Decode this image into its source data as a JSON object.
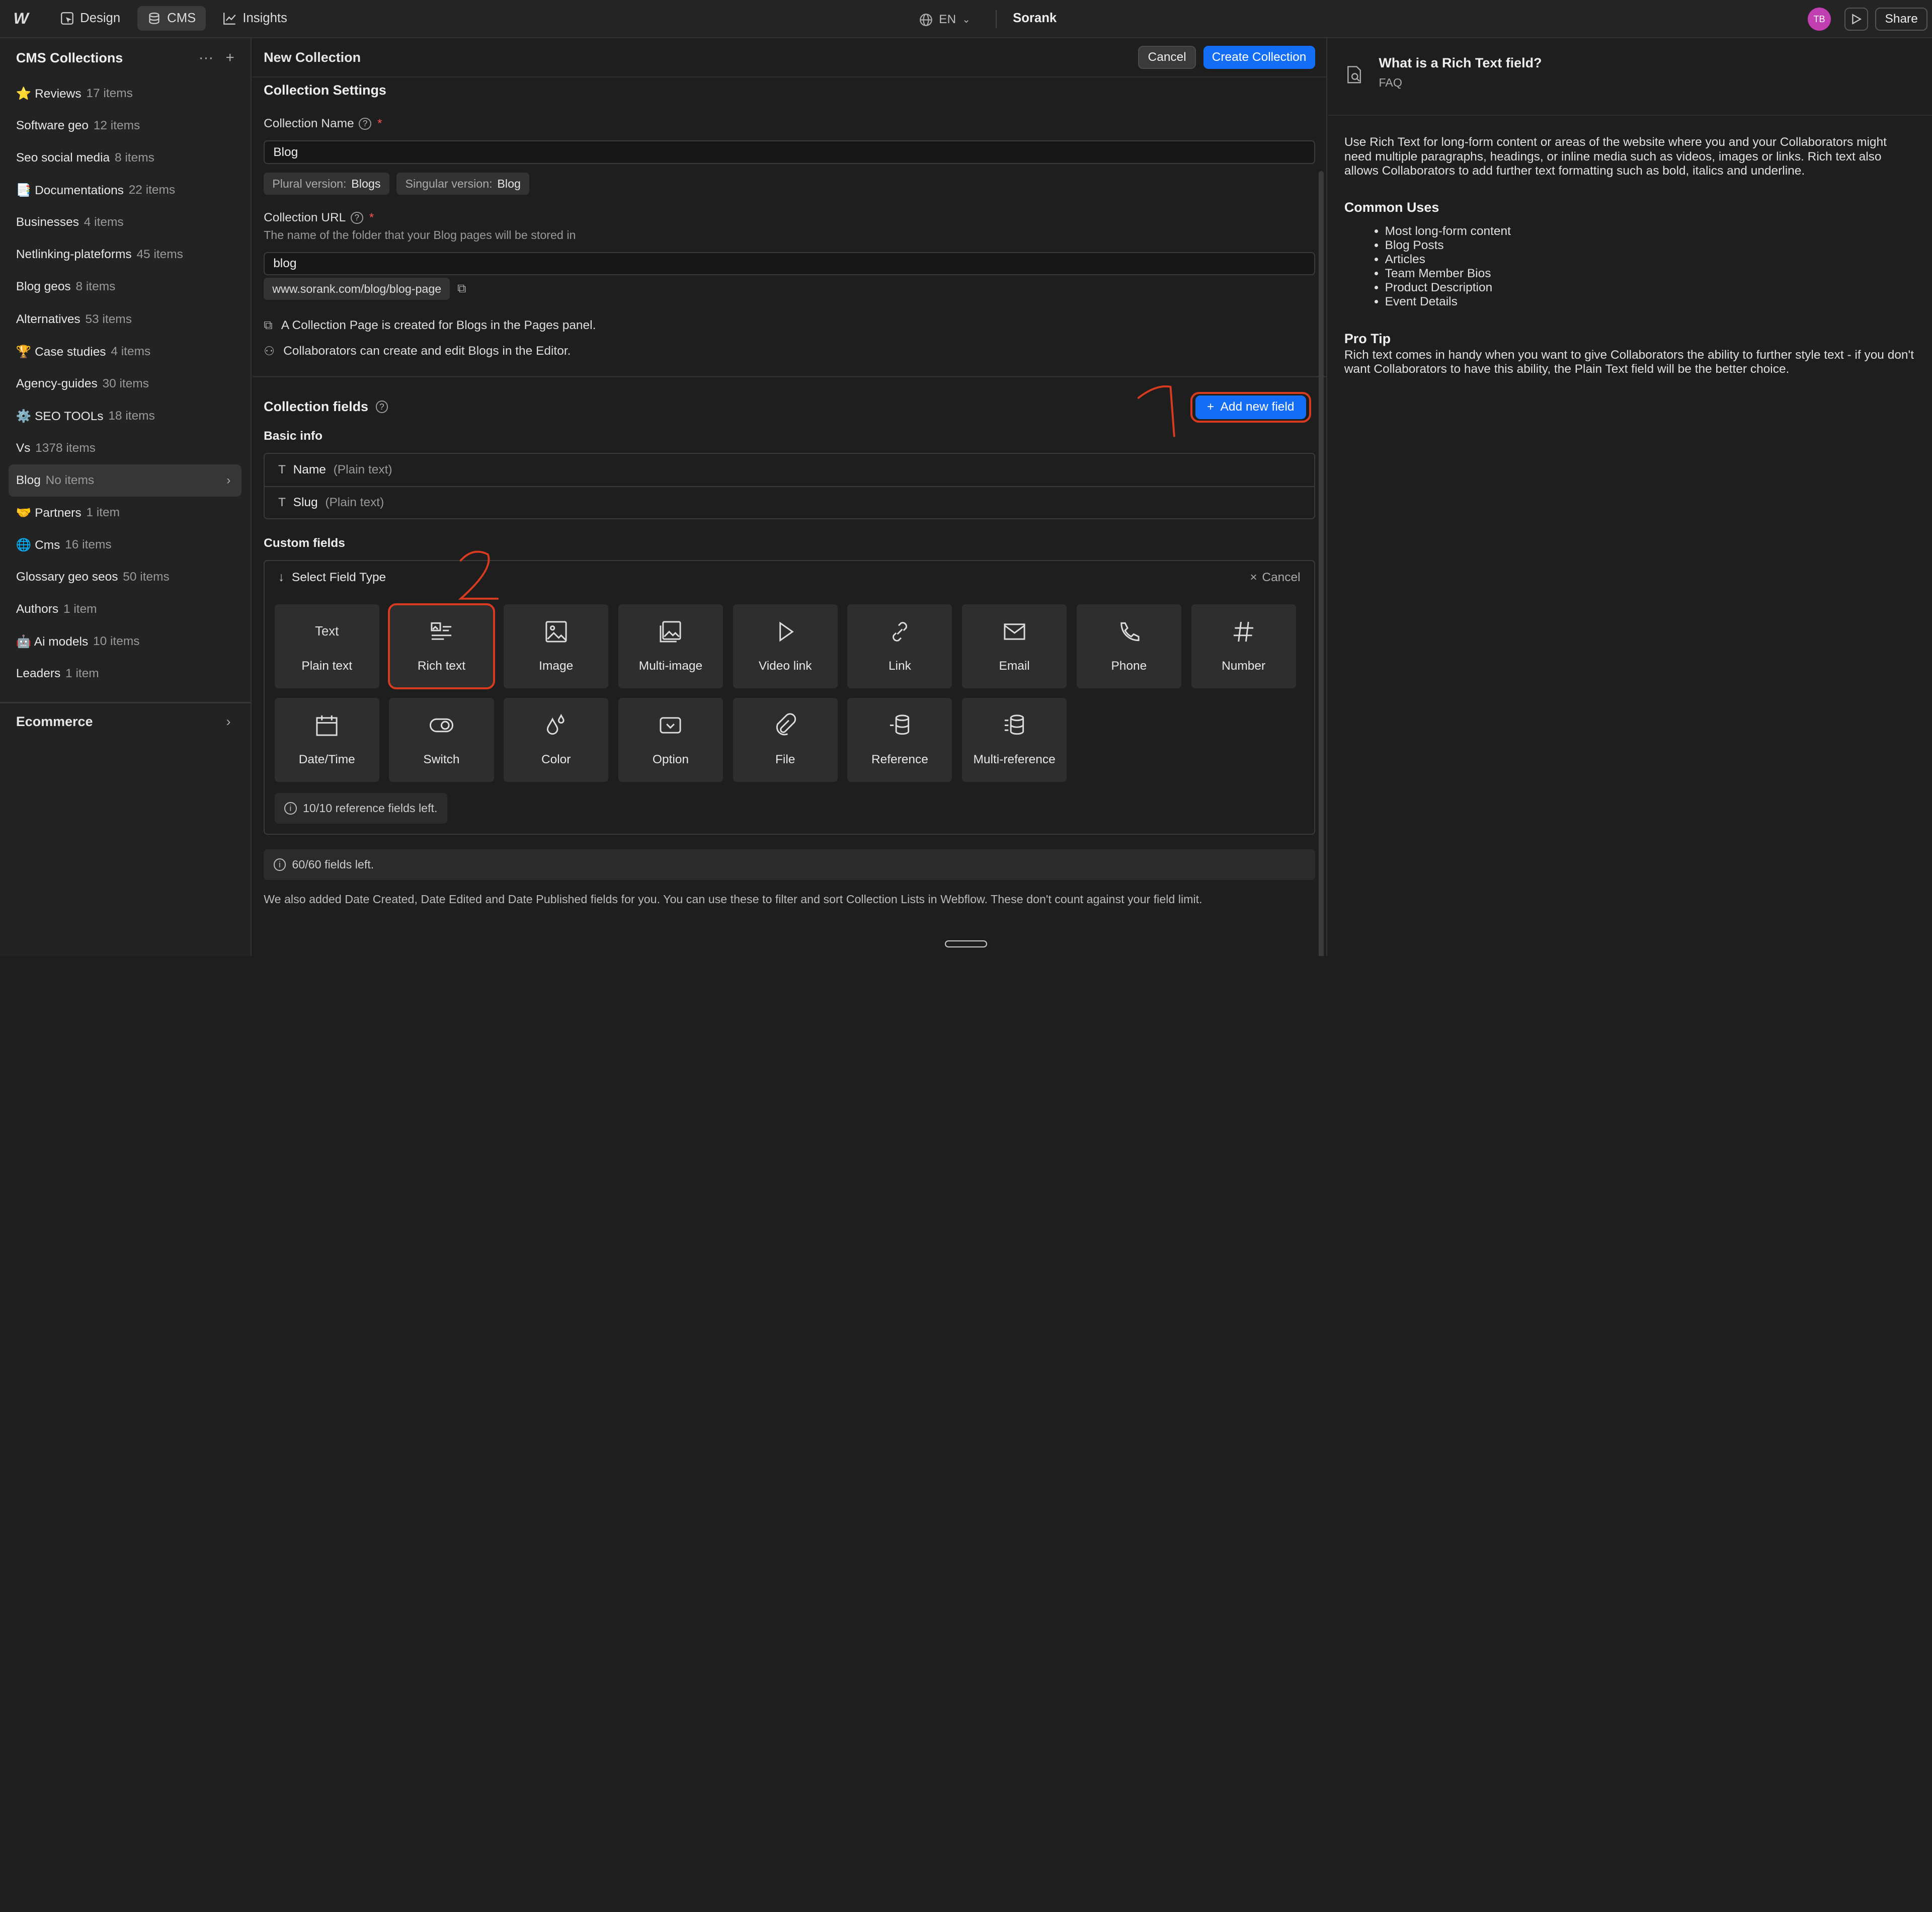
{
  "topbar": {
    "tabs": [
      {
        "label": "Design",
        "icon": "design-icon"
      },
      {
        "label": "CMS",
        "icon": "database-icon"
      },
      {
        "label": "Insights",
        "icon": "chart-icon"
      }
    ],
    "language": "EN",
    "site_name": "Sorank",
    "avatar_initials": "TB",
    "share_label": "Share"
  },
  "sidebar": {
    "title": "CMS Collections",
    "items": [
      {
        "label": "⭐ Reviews",
        "count": "17 items"
      },
      {
        "label": "Software geo",
        "count": "12 items"
      },
      {
        "label": "Seo social media",
        "count": "8 items"
      },
      {
        "label": "📑 Documentations",
        "count": "22 items"
      },
      {
        "label": "Businesses",
        "count": "4 items"
      },
      {
        "label": "Netlinking-plateforms",
        "count": "45 items"
      },
      {
        "label": "Blog geos",
        "count": "8 items"
      },
      {
        "label": "Alternatives",
        "count": "53 items"
      },
      {
        "label": "🏆 Case studies",
        "count": "4 items"
      },
      {
        "label": "Agency-guides",
        "count": "30 items"
      },
      {
        "label": "⚙️ SEO TOOLs",
        "count": "18 items"
      },
      {
        "label": "Vs",
        "count": "1378 items"
      },
      {
        "label": "Blog",
        "count": "No items"
      },
      {
        "label": "🤝 Partners",
        "count": "1 item"
      },
      {
        "label": "🌐 Cms",
        "count": "16 items"
      },
      {
        "label": "Glossary geo seos",
        "count": "50 items"
      },
      {
        "label": "Authors",
        "count": "1 item"
      },
      {
        "label": "🤖 Ai models",
        "count": "10 items"
      },
      {
        "label": "Leaders",
        "count": "1 item"
      }
    ],
    "selected_index": 12,
    "ecommerce_label": "Ecommerce"
  },
  "main": {
    "title": "New Collection",
    "cancel_label": "Cancel",
    "create_label": "Create Collection",
    "settings": {
      "section_title": "Collection Settings",
      "name_label": "Collection Name",
      "name_value": "Blog",
      "plural_label": "Plural version:",
      "plural_value": "Blogs",
      "singular_label": "Singular version:",
      "singular_value": "Blog",
      "url_label": "Collection URL",
      "url_help": "The name of the folder that your Blog pages will be stored in",
      "url_value": "blog",
      "url_preview": "www.sorank.com/blog/blog-page",
      "info1": "A Collection Page is created for Blogs in the Pages panel.",
      "info2": "Collaborators can create and edit Blogs in the Editor."
    },
    "fields": {
      "section_title": "Collection fields",
      "add_label": "Add new field",
      "basic_title": "Basic info",
      "basic": [
        {
          "name": "Name",
          "type": "(Plain text)"
        },
        {
          "name": "Slug",
          "type": "(Plain text)"
        }
      ],
      "custom_title": "Custom fields",
      "select_label": "Select Field Type",
      "cancel_label": "Cancel",
      "types": [
        {
          "label": "Plain text",
          "icon": "text-icon"
        },
        {
          "label": "Rich text",
          "icon": "rich-text-icon"
        },
        {
          "label": "Image",
          "icon": "image-icon"
        },
        {
          "label": "Multi-image",
          "icon": "multi-image-icon"
        },
        {
          "label": "Video link",
          "icon": "play-icon"
        },
        {
          "label": "Link",
          "icon": "link-icon"
        },
        {
          "label": "Email",
          "icon": "email-icon"
        },
        {
          "label": "Phone",
          "icon": "phone-icon"
        },
        {
          "label": "Number",
          "icon": "hash-icon"
        },
        {
          "label": "Date/Time",
          "icon": "calendar-icon"
        },
        {
          "label": "Switch",
          "icon": "switch-icon"
        },
        {
          "label": "Color",
          "icon": "color-drop-icon"
        },
        {
          "label": "Option",
          "icon": "option-icon"
        },
        {
          "label": "File",
          "icon": "paperclip-icon"
        },
        {
          "label": "Reference",
          "icon": "reference-icon"
        },
        {
          "label": "Multi-reference",
          "icon": "multi-reference-icon"
        }
      ],
      "text_glyph": "Text",
      "reference_left": "10/10 reference fields left.",
      "fields_left": "60/60 fields left.",
      "footnote": "We also added Date Created, Date Edited and Date Published fields for you. You can use these to filter and sort Collection Lists in Webflow. These don't count against your field limit."
    }
  },
  "annotations": {
    "one": "1",
    "two": "2",
    "color": "#d93b20"
  },
  "faq": {
    "title": "What is a Rich Text field?",
    "subtitle": "FAQ",
    "intro": "Use Rich Text for long-form content or areas of the website where you and your Collaborators might need multiple paragraphs, headings, or inline media such as videos, images or links. Rich text also allows Collaborators to add further text formatting such as bold, italics and underline.",
    "uses_title": "Common Uses",
    "uses": [
      "Most long-form content",
      "Blog Posts",
      "Articles",
      "Team Member Bios",
      "Product Description",
      "Event Details"
    ],
    "tip_title": "Pro Tip",
    "tip": "Rich text comes in handy when you want to give Collaborators the ability to further style text - if you don't want Collaborators to have this ability, the Plain Text field will be the better choice."
  },
  "colors": {
    "accent": "#146ef5",
    "annotation": "#d93b20",
    "avatar": "#c23fb2"
  }
}
